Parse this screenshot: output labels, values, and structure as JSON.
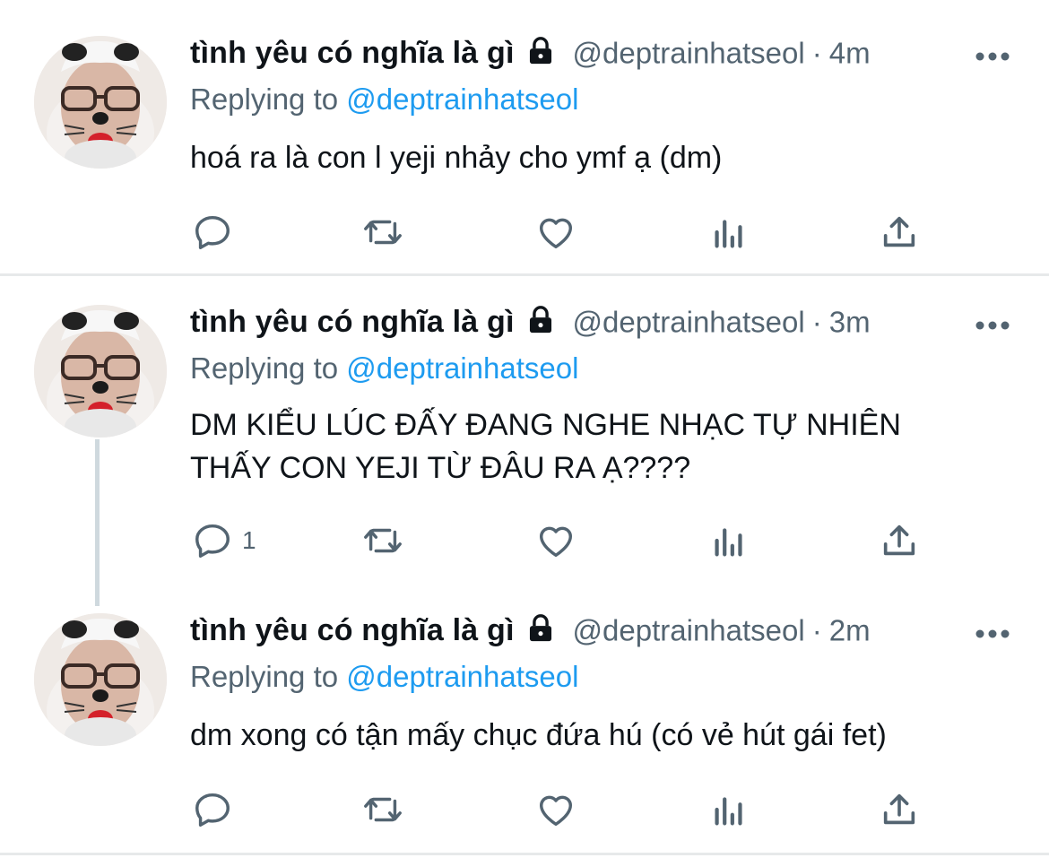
{
  "tweets": [
    {
      "name": "tình yêu có nghĩa là gì",
      "handle": "@deptrainhatseol",
      "separator": "·",
      "time": "4m",
      "replying_prefix": "Replying to",
      "replying_to": "@deptrainhatseol",
      "text": "hoá ra là con l yeji nhảy cho ymf ạ (dm)",
      "reply_count": ""
    },
    {
      "name": "tình yêu có nghĩa là gì",
      "handle": "@deptrainhatseol",
      "separator": "·",
      "time": "3m",
      "replying_prefix": "Replying to",
      "replying_to": "@deptrainhatseol",
      "text_lines": [
        "DM KIỂU LÚC ĐẤY ĐANG NGHE NHẠC TỰ NHIÊN",
        "THẤY CON YEJI TỪ ĐÂU RA Ạ????"
      ],
      "reply_count": "1"
    },
    {
      "name": "tình yêu có nghĩa là gì",
      "handle": "@deptrainhatseol",
      "separator": "·",
      "time": "2m",
      "replying_prefix": "Replying to",
      "replying_to": "@deptrainhatseol",
      "text": "dm xong có tận mấy chục đứa hú (có vẻ hút gái fet)",
      "reply_count": ""
    }
  ],
  "icons": {
    "avatar": "avatar-photo",
    "lock": "lock-icon",
    "more": "more-icon",
    "reply": "reply-icon",
    "retweet": "retweet-icon",
    "like": "like-icon",
    "analytics": "analytics-icon",
    "share": "share-icon"
  },
  "colors": {
    "text": "#0f1419",
    "secondary": "#536471",
    "link": "#1d9bf0",
    "divider": "#e7e9ea",
    "thread_line": "#cfd9de"
  }
}
